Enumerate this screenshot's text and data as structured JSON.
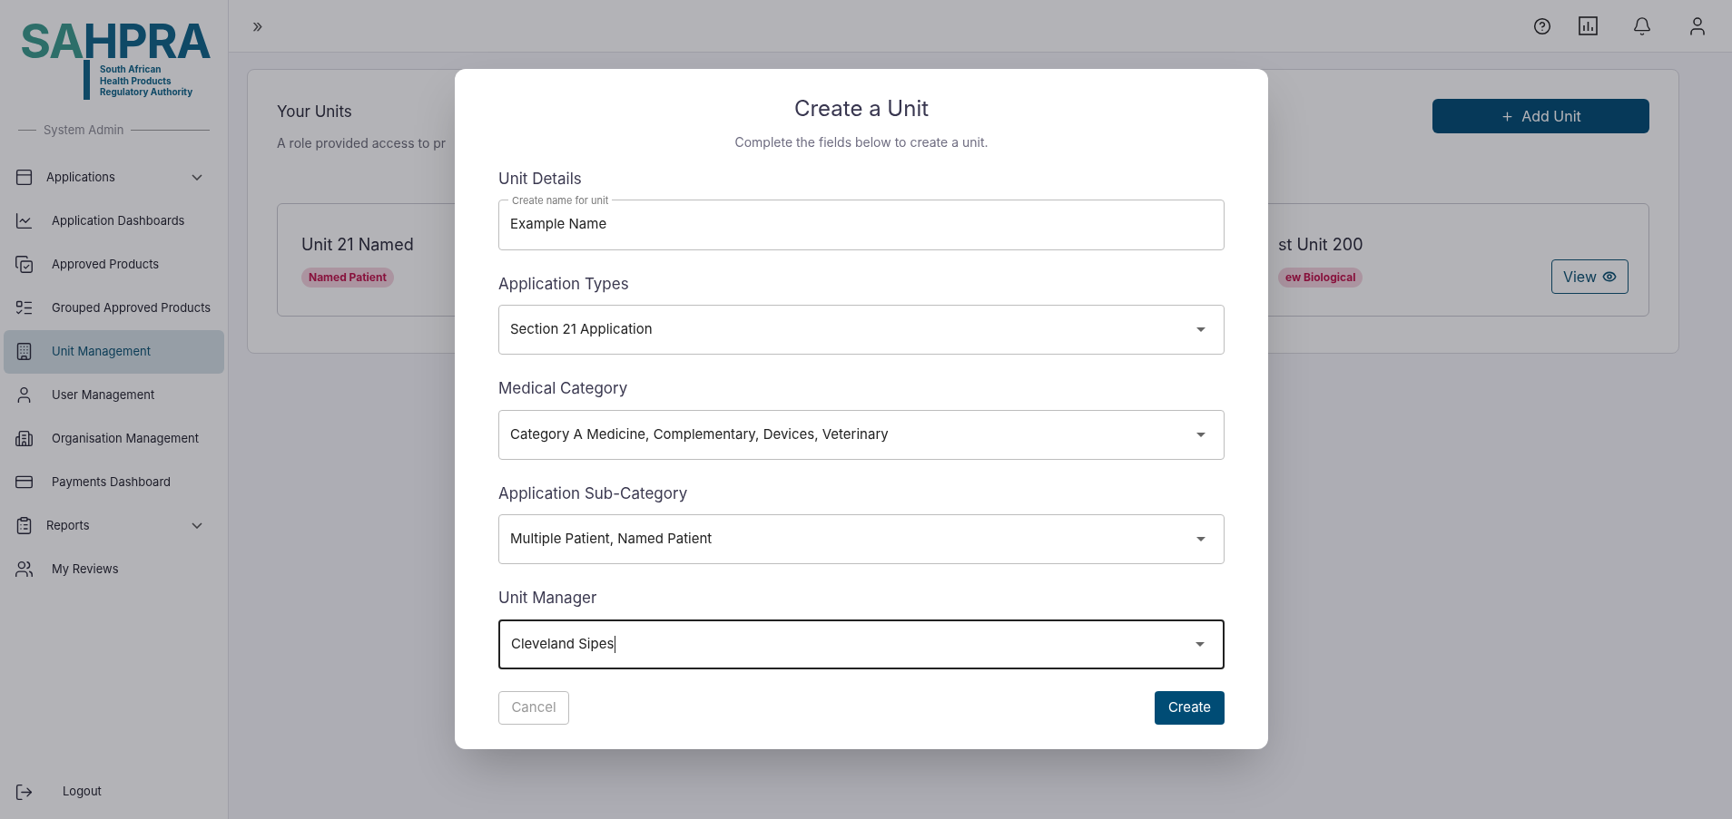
{
  "logo": {
    "part_1": "SA",
    "part_2": "HPRA",
    "tagline": [
      "South African",
      "Health Products",
      "Regulatory Authority"
    ]
  },
  "sidebar": {
    "section": "System Admin",
    "items": [
      {
        "kind": "group",
        "label": "Applications",
        "selected": false
      },
      {
        "kind": "link",
        "label": "Application Dashboards",
        "selected": false
      },
      {
        "kind": "link",
        "label": "Approved Products",
        "selected": false
      },
      {
        "kind": "link",
        "label": "Grouped Approved Products",
        "selected": false
      },
      {
        "kind": "link",
        "label": "Unit Management",
        "selected": true
      },
      {
        "kind": "link",
        "label": "User Management",
        "selected": false
      },
      {
        "kind": "link",
        "label": "Organisation Management",
        "selected": false
      },
      {
        "kind": "link",
        "label": "Payments Dashboard",
        "selected": false
      },
      {
        "kind": "group",
        "label": "Reports",
        "selected": false
      },
      {
        "kind": "link",
        "label": "My Reviews",
        "selected": false
      }
    ],
    "logout": "Logout"
  },
  "topbar": {
    "expand": "»"
  },
  "units": {
    "title": "Your Units",
    "description": "A role provided access to pr",
    "add_button": "Add Unit",
    "cards": [
      {
        "title": "Unit 21 Named",
        "tag": "Named Patient"
      },
      {
        "title": "st Unit 200",
        "tag": "ew Biological",
        "view_button": "View"
      }
    ]
  },
  "modal": {
    "title": "Create a Unit",
    "subtitle": "Complete the fields below to create a unit.",
    "fields": [
      {
        "kind": "text",
        "heading": "Unit Details",
        "label": "Create name for unit",
        "value": "Example Name",
        "focused": false
      },
      {
        "kind": "select",
        "heading": "Application Types",
        "value": "Section 21 Application",
        "focused": false
      },
      {
        "kind": "select",
        "heading": "Medical Category",
        "value": "Category A Medicine, Complementary, Devices, Veterinary",
        "focused": false
      },
      {
        "kind": "select",
        "heading": "Application Sub-Category",
        "value": "Multiple Patient, Named Patient",
        "focused": false
      },
      {
        "kind": "select",
        "heading": "Unit Manager",
        "value": "Cleveland Sipes",
        "focused": true
      }
    ],
    "cancel": {
      "label": "Cancel",
      "disabled": true
    },
    "create": "Create"
  }
}
